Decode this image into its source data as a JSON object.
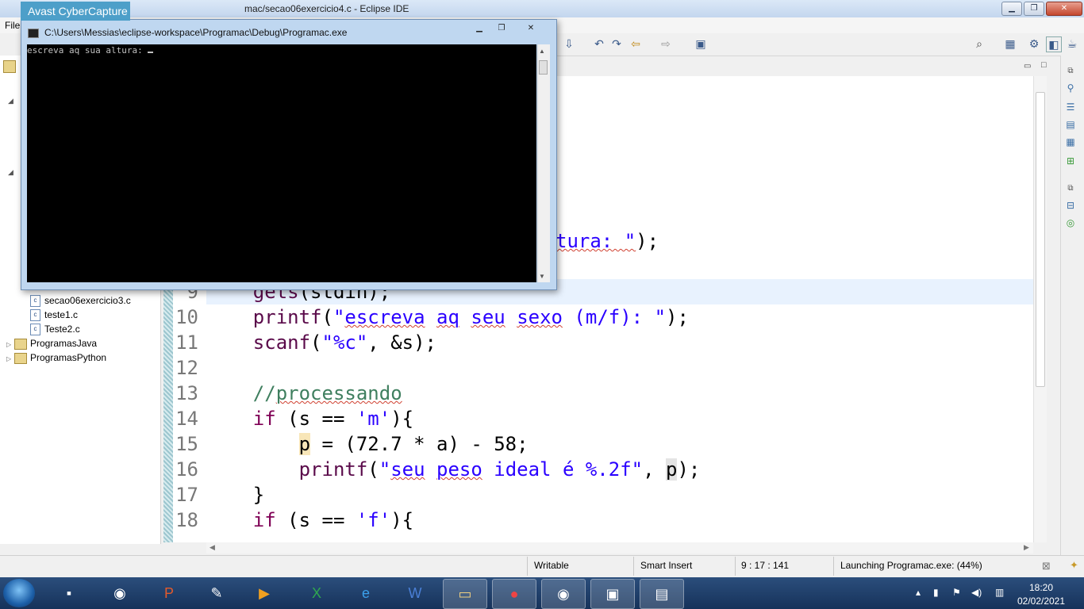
{
  "eclipse": {
    "title": "mac/secao06exercicio4.c - Eclipse IDE",
    "menu_first": "File"
  },
  "explorer": {
    "items": [
      {
        "label": "secao06exercicio3.c",
        "kind": "file"
      },
      {
        "label": "teste1.c",
        "kind": "file"
      },
      {
        "label": "Teste2.c",
        "kind": "file"
      },
      {
        "label": "ProgramasJava",
        "kind": "project"
      },
      {
        "label": "ProgramasPython",
        "kind": "project"
      }
    ]
  },
  "editor": {
    "partial_line": "tura: \");",
    "lines": [
      {
        "n": "9",
        "text": "gets(stdin);"
      },
      {
        "n": "10",
        "text": "printf(\"escreva aq seu sexo (m/f): \");"
      },
      {
        "n": "11",
        "text": "scanf(\"%c\", &s);"
      },
      {
        "n": "12",
        "text": ""
      },
      {
        "n": "13",
        "text": "//processando"
      },
      {
        "n": "14",
        "text": "if (s == 'm'){"
      },
      {
        "n": "15",
        "text": "p = (72.7 * a) - 58;"
      },
      {
        "n": "16",
        "text": "printf(\"seu peso ideal é %.2f\", p);"
      },
      {
        "n": "17",
        "text": "}"
      },
      {
        "n": "18",
        "text": "if (s == 'f'){"
      }
    ]
  },
  "status": {
    "writable": "Writable",
    "insert_mode": "Smart Insert",
    "position": "9 : 17 : 141",
    "launch": "Launching Programac.exe: (44%)"
  },
  "console": {
    "title": "C:\\Users\\Messias\\eclipse-workspace\\Programac\\Debug\\Programac.exe",
    "output": "escreva aq sua altura: "
  },
  "avast": {
    "label": "Avast CyberCapture"
  },
  "taskbar": {
    "time": "18:20",
    "date": "02/02/2021"
  }
}
